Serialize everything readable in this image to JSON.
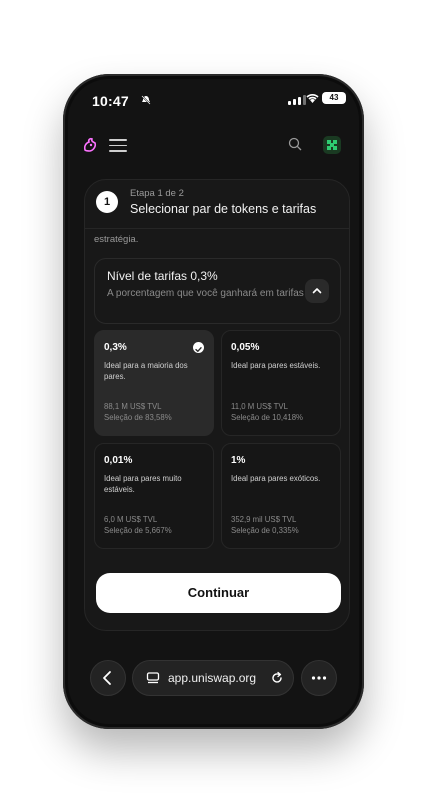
{
  "status_bar": {
    "time": "10:47",
    "battery": "43"
  },
  "step": {
    "number": "1",
    "label": "Etapa 1 de 2",
    "title": "Selecionar par de tokens e tarifas"
  },
  "strategy_text": "estratégia.",
  "fee_tier": {
    "title": "Nível de tarifas 0,3%",
    "description": "A porcentagem que você ganhará em tarifas"
  },
  "fee_options": [
    {
      "fee": "0,3%",
      "description": "Ideal para a maioria dos pares.",
      "tvl": "88,1 M US$ TVL",
      "selection": "Seleção de 83,58%",
      "selected": true
    },
    {
      "fee": "0,05%",
      "description": "Ideal para pares estáveis.",
      "tvl": "11,0 M US$ TVL",
      "selection": "Seleção de 10,418%",
      "selected": false
    },
    {
      "fee": "0,01%",
      "description": "Ideal para pares muito estáveis.",
      "tvl": "6,0 M US$ TVL",
      "selection": "Seleção de 5,667%",
      "selected": false
    },
    {
      "fee": "1%",
      "description": "Ideal para pares exóticos.",
      "tvl": "352,9 mil US$ TVL",
      "selection": "Seleção de 0,335%",
      "selected": false
    }
  ],
  "continue_label": "Continuar",
  "browser": {
    "url": "app.uniswap.org"
  },
  "colors": {
    "brand": "#FC72FF",
    "avatar": "#2ECC71",
    "background": "#131313"
  }
}
